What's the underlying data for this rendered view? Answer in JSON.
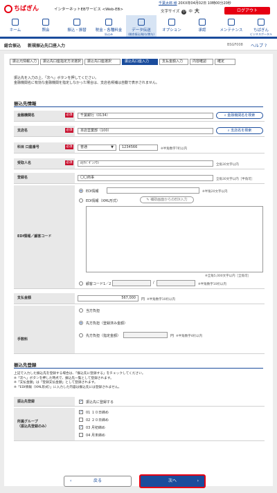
{
  "header": {
    "logo_text": "ちばぎん",
    "service_name": "インターネットEBサービス <Web-EB>",
    "user_name": "千葉太郎 様",
    "last_login": "20XX年04月02日 10時00分20秒",
    "font_size_label": "文字サイズ",
    "font_small": "小",
    "font_medium": "中",
    "font_large": "大",
    "logout_label": "ログアウト"
  },
  "nav": {
    "items": [
      {
        "label": "ホーム",
        "sub": ""
      },
      {
        "label": "照会",
        "sub": ""
      },
      {
        "label": "振込・振替",
        "sub": ""
      },
      {
        "label": "税金・各種料金",
        "sub": "払込み"
      },
      {
        "label": "データ伝送",
        "sub": "(総合振込/給与/賞与)"
      },
      {
        "label": "オプション",
        "sub": ""
      },
      {
        "label": "承認",
        "sub": ""
      },
      {
        "label": "メンテナンス",
        "sub": ""
      },
      {
        "label": "ちばぎん",
        "sub": "ビジネスポータル"
      }
    ]
  },
  "subbar": {
    "section": "総合振込",
    "title": "新規振込先口座入力",
    "screen_id": "BSGF008",
    "help_label": "ヘルプ"
  },
  "steps": [
    "振込元情報入力",
    "振込先口座指定方法選択",
    "振込先口座選択",
    "振込先口座入力",
    "支払金額入力",
    "内容確認",
    "確定"
  ],
  "message": [
    "振込先を入力の上、「次へ」ボタンを押してください。",
    "金融機関名に有効な金融機関を指定しなかった場合は、支店名候補は自動で表示されません。"
  ],
  "transfer_info": {
    "title": "振込先情報",
    "required_label": "必須",
    "bank": {
      "label": "金融機関名",
      "value": "千葉銀行（0134）",
      "button": "金融機関名を検索"
    },
    "branch": {
      "label": "支店名",
      "value": "本店営業部（100）",
      "button": "支店名を検索"
    },
    "account": {
      "label": "科目 口座番号",
      "type": "普通",
      "number": "1234566",
      "note": "※半角数字7桁以内"
    },
    "kana": {
      "label": "受取人名",
      "value": "ｶ)ﾁﾊﾞｷﾞﾝｿｳｼ",
      "note": "全角30文字以内"
    },
    "reg_name": {
      "label": "登録名",
      "value": "〇〇商事",
      "note": "全角30文字以内［半角可］"
    },
    "edi": {
      "label": "EDI情報／顧客コード",
      "edi_option": "EDI情報",
      "edi_note": "※半角20文字以内",
      "xml_option": "EDI情報（XML形式）",
      "xml_button": "補助画面からのEDI入力",
      "xml_note": "※全角5,000文字以内［全角可］",
      "cust_option": "顧客コード1／2",
      "cust_note": "※半角数字10桁以内"
    },
    "amount": {
      "label": "支払金額",
      "value": "567,000",
      "unit": "円",
      "note": "※半角数字10桁以内"
    },
    "fee": {
      "label": "手数料",
      "opt1": "当方負担",
      "opt2": "先方負担（登録済み金額）",
      "opt3": "先方負担（指定金額）",
      "unit": "円",
      "note": "※半角数字4桁以内"
    }
  },
  "registration": {
    "title": "振込先登録",
    "notes": [
      "上記で入力した振込先を登録する場合は、「振込先に登録する」をチェックしてください。",
      "※「次へ」ボタンを押した時点で、振込先一覧として登録されます。",
      "※「支払金額」は「登録支払金額」として登録されます。",
      "※「EDI情報（XML形式）」に入力した内容は振込先には登録されません。"
    ],
    "reg_label": "振込先登録",
    "reg_check": "振込先に登録する",
    "group_label": "所属グループ\n（振込先登録のみ）",
    "groups": [
      {
        "label": "01 １０日締め",
        "checked": true
      },
      {
        "label": "02 ２０日締め",
        "checked": false
      },
      {
        "label": "03 月初締め",
        "checked": true
      },
      {
        "label": "04 月末締め",
        "checked": false
      }
    ]
  },
  "footer": {
    "back_label": "戻る",
    "next_label": "次へ"
  }
}
